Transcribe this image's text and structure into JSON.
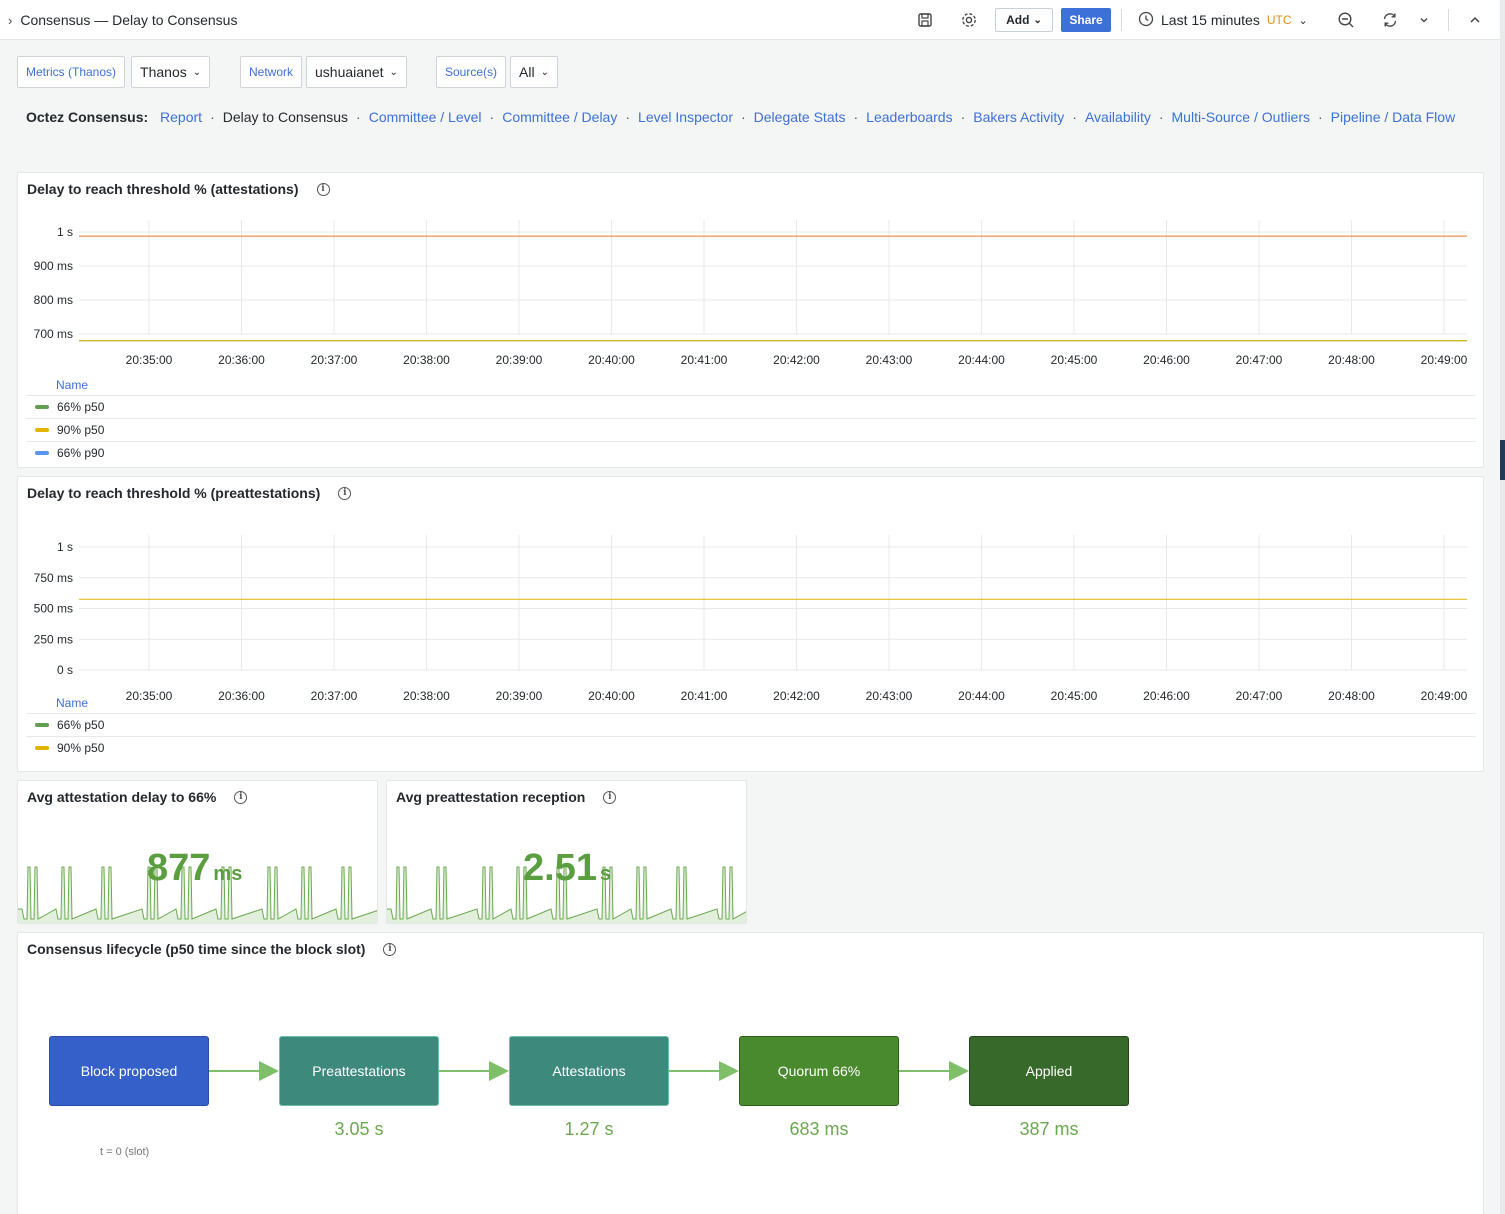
{
  "header": {
    "breadcrumb": "Consensus — Delay to Consensus",
    "add_label": "Add",
    "share_label": "Share",
    "time_range": "Last 15 minutes",
    "timezone": "UTC"
  },
  "variables": [
    {
      "label": "Metrics (Thanos)",
      "value": "Thanos"
    },
    {
      "label": "Network",
      "value": "ushuaianet"
    },
    {
      "label": "Source(s)",
      "value": "All"
    }
  ],
  "nav": {
    "lead": "Octez Consensus:",
    "items": [
      "Report",
      "Delay to Consensus",
      "Committee / Level",
      "Committee / Delay",
      "Level Inspector",
      "Delegate Stats",
      "Leaderboards",
      "Bakers Activity",
      "Availability",
      "Multi-Source / Outliers",
      "Pipeline / Data Flow"
    ],
    "current": "Delay to Consensus"
  },
  "panels": {
    "attestations": {
      "title": "Delay to reach threshold % (attestations)",
      "legend_header": "Name",
      "legend": [
        {
          "name": "66% p50",
          "color": "#629e51"
        },
        {
          "name": "90% p50",
          "color": "#e0b400"
        },
        {
          "name": "66% p90",
          "color": "#5794f2"
        }
      ]
    },
    "preattestations": {
      "title": "Delay to reach threshold % (preattestations)",
      "legend_header": "Name",
      "legend": [
        {
          "name": "66% p50",
          "color": "#629e51"
        },
        {
          "name": "90% p50",
          "color": "#e0b400"
        }
      ]
    },
    "avg_attestation": {
      "title": "Avg attestation delay to 66%",
      "value": "877",
      "unit": "ms"
    },
    "avg_preattestation": {
      "title": "Avg preattestation reception",
      "value": "2.51",
      "unit": "s"
    },
    "lifecycle": {
      "title": "Consensus lifecycle (p50 time since the block slot)",
      "nodes": [
        {
          "label": "Block proposed",
          "value": "",
          "color": "#3560c9",
          "sub": "t = 0 (slot)"
        },
        {
          "label": "Preattestations",
          "value": "3.05 s",
          "color": "#3d8a7c",
          "sub": ""
        },
        {
          "label": "Attestations",
          "value": "1.27 s",
          "color": "#3d8a7c",
          "sub": ""
        },
        {
          "label": "Quorum 66%",
          "value": "683 ms",
          "color": "#4a8a2e",
          "sub": ""
        },
        {
          "label": "Applied",
          "value": "387 ms",
          "color": "#36692a",
          "sub": ""
        }
      ]
    }
  },
  "chart_data": [
    {
      "type": "line",
      "title": "Delay to reach threshold % (attestations)",
      "x": [
        "20:35:00",
        "20:36:00",
        "20:37:00",
        "20:38:00",
        "20:39:00",
        "20:40:00",
        "20:41:00",
        "20:42:00",
        "20:43:00",
        "20:44:00",
        "20:45:00",
        "20:46:00",
        "20:47:00",
        "20:48:00",
        "20:49:00"
      ],
      "y_ticks": [
        "700 ms",
        "800 ms",
        "900 ms",
        "1 s"
      ],
      "ylim": [
        700,
        1000
      ],
      "series": [
        {
          "name": "66% p50",
          "color": "#629e51",
          "values": [
            680,
            680,
            680,
            680,
            680,
            680,
            680,
            680,
            680,
            680,
            680,
            680,
            680,
            680,
            680
          ]
        },
        {
          "name": "90% p50",
          "color": "#e0b400",
          "values": [
            680,
            680,
            680,
            680,
            680,
            680,
            680,
            680,
            680,
            680,
            680,
            680,
            680,
            680,
            680
          ]
        },
        {
          "name": "66% p90",
          "color": "#e8732a",
          "values": [
            988,
            988,
            988,
            988,
            988,
            988,
            988,
            988,
            988,
            988,
            988,
            988,
            988,
            988,
            988
          ]
        }
      ]
    },
    {
      "type": "line",
      "title": "Delay to reach threshold % (preattestations)",
      "x": [
        "20:35:00",
        "20:36:00",
        "20:37:00",
        "20:38:00",
        "20:39:00",
        "20:40:00",
        "20:41:00",
        "20:42:00",
        "20:43:00",
        "20:44:00",
        "20:45:00",
        "20:46:00",
        "20:47:00",
        "20:48:00",
        "20:49:00"
      ],
      "y_ticks": [
        "0 s",
        "250 ms",
        "500 ms",
        "750 ms",
        "1 s"
      ],
      "ylim": [
        0,
        1000
      ],
      "series": [
        {
          "name": "90% p50",
          "color": "#e0b400",
          "values": [
            575,
            575,
            575,
            575,
            575,
            575,
            575,
            575,
            575,
            575,
            575,
            575,
            575,
            575,
            575
          ]
        }
      ]
    }
  ]
}
